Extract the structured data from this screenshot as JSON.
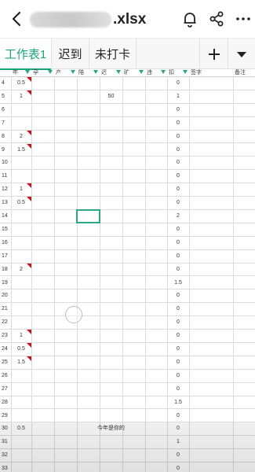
{
  "file": {
    "ext": ".xlsx"
  },
  "tabs": [
    {
      "label": "工作表1",
      "active": true
    },
    {
      "label": "迟到",
      "active": false
    },
    {
      "label": "未打卡",
      "active": false
    }
  ],
  "columns": [
    "年",
    "孕",
    "产",
    "陪",
    "迟",
    "旷",
    "违",
    "扣",
    "签字",
    "备注"
  ],
  "rows": [
    {
      "n": "4",
      "a": "0.5",
      "e": "",
      "h": "0"
    },
    {
      "n": "5",
      "a": "1",
      "e": "50",
      "h": "1"
    },
    {
      "n": "6",
      "a": "",
      "e": "",
      "h": "0"
    },
    {
      "n": "7",
      "a": "",
      "e": "",
      "h": "0"
    },
    {
      "n": "8",
      "a": "2",
      "e": "",
      "h": "0"
    },
    {
      "n": "9",
      "a": "1.5",
      "e": "",
      "h": "0"
    },
    {
      "n": "10",
      "a": "",
      "e": "",
      "h": "0"
    },
    {
      "n": "11",
      "a": "",
      "e": "",
      "h": "0"
    },
    {
      "n": "12",
      "a": "1",
      "e": "",
      "h": "0"
    },
    {
      "n": "13",
      "a": "0.5",
      "e": "",
      "h": "0"
    },
    {
      "n": "14",
      "a": "",
      "e": "",
      "h": "2"
    },
    {
      "n": "15",
      "a": "",
      "e": "",
      "h": "0"
    },
    {
      "n": "16",
      "a": "",
      "e": "",
      "h": "0"
    },
    {
      "n": "17",
      "a": "",
      "e": "",
      "h": "0"
    },
    {
      "n": "18",
      "a": "2",
      "e": "",
      "h": "0"
    },
    {
      "n": "19",
      "a": "",
      "e": "",
      "h": "1.5"
    },
    {
      "n": "20",
      "a": "",
      "e": "",
      "h": "0"
    },
    {
      "n": "21",
      "a": "",
      "e": "",
      "h": "0"
    },
    {
      "n": "22",
      "a": "",
      "e": "",
      "h": "0"
    },
    {
      "n": "23",
      "a": "1",
      "e": "",
      "h": "0"
    },
    {
      "n": "24",
      "a": "0.5",
      "e": "",
      "h": "0"
    },
    {
      "n": "25",
      "a": "1.5",
      "e": "",
      "h": "0"
    },
    {
      "n": "26",
      "a": "",
      "e": "",
      "h": "0"
    },
    {
      "n": "27",
      "a": "",
      "e": "",
      "h": "0"
    },
    {
      "n": "28",
      "a": "",
      "e": "",
      "h": "1.5"
    },
    {
      "n": "29",
      "a": "",
      "e": "",
      "h": "0"
    },
    {
      "n": "30",
      "a": "0.5",
      "e": "",
      "h": "0",
      "note": "今年是你的"
    },
    {
      "n": "31",
      "a": "",
      "e": "",
      "h": "1"
    },
    {
      "n": "32",
      "a": "",
      "e": "",
      "h": "0"
    },
    {
      "n": "33",
      "a": "",
      "e": "",
      "h": "0"
    }
  ],
  "commentedRows": [
    "4",
    "5",
    "8",
    "9",
    "12",
    "13",
    "18",
    "23",
    "24",
    "25"
  ],
  "selectedRow": "14",
  "colors": {
    "accent": "#1aa47b",
    "comment": "#c0161b"
  },
  "icons": [
    "back-arrow-icon",
    "bell-icon",
    "share-icon",
    "more-icon",
    "plus-icon",
    "dropdown-icon"
  ]
}
